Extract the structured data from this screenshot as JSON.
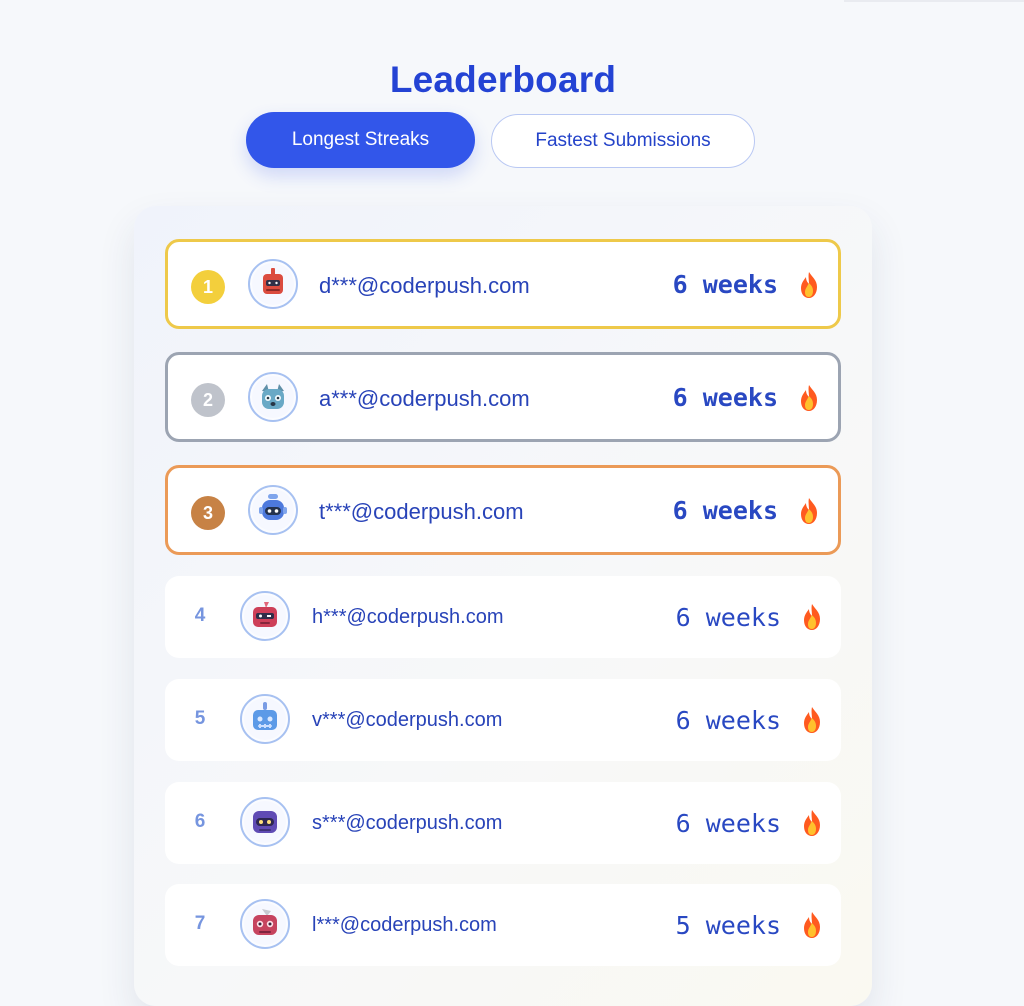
{
  "page": {
    "title": "Leaderboard"
  },
  "tabs": [
    {
      "label": "Longest Streaks",
      "active": true
    },
    {
      "label": "Fastest Submissions",
      "active": false
    }
  ],
  "leaderboard": [
    {
      "rank": "1",
      "email": "d***@coderpush.com",
      "streak": "6 weeks",
      "avatar_icon": "red-robot-avatar-icon",
      "medal_color": "#f3cf3c"
    },
    {
      "rank": "2",
      "email": "a***@coderpush.com",
      "streak": "6 weeks",
      "avatar_icon": "blue-robot-avatar-icon",
      "medal_color": "#bfc3cb"
    },
    {
      "rank": "3",
      "email": "t***@coderpush.com",
      "streak": "6 weeks",
      "avatar_icon": "blue-robot-avatar-icon",
      "medal_color": "#c78245"
    },
    {
      "rank": "4",
      "email": "h***@coderpush.com",
      "streak": "6 weeks",
      "avatar_icon": "red-robot-avatar-icon"
    },
    {
      "rank": "5",
      "email": "v***@coderpush.com",
      "streak": "6 weeks",
      "avatar_icon": "blue-robot-avatar-icon"
    },
    {
      "rank": "6",
      "email": "s***@coderpush.com",
      "streak": "6 weeks",
      "avatar_icon": "purple-robot-avatar-icon"
    },
    {
      "rank": "7",
      "email": "l***@coderpush.com",
      "streak": "5 weeks",
      "avatar_icon": "red-robot-avatar-icon"
    }
  ],
  "icons": {
    "streak": "fire-icon"
  },
  "colors": {
    "accent": "#3256ea",
    "gold_border": "#eec94a",
    "silver_border": "#9ca4b2",
    "bronze_border": "#eb9a57"
  }
}
